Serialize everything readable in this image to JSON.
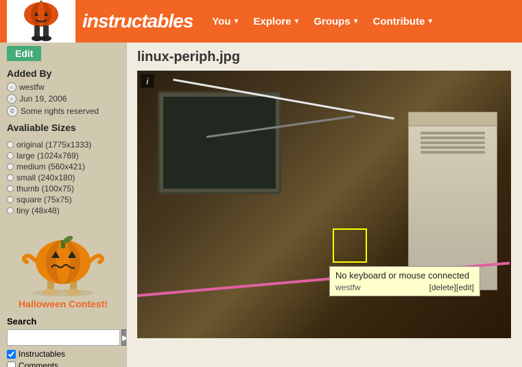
{
  "header": {
    "logo_text": "instructables",
    "nav": [
      {
        "label": "You",
        "arrow": "▼"
      },
      {
        "label": "Explore",
        "arrow": "▼"
      },
      {
        "label": "Groups",
        "arrow": "▼"
      },
      {
        "label": "Contribute",
        "arrow": "▼"
      }
    ]
  },
  "sidebar": {
    "edit_btn": "Edit",
    "added_by_label": "Added By",
    "author": "westfw",
    "date": "Jun 19, 2006",
    "rights": "Some rights reserved",
    "sizes_title": "Avaliable Sizes",
    "sizes": [
      "original (1775x1333)",
      "large (1024x769)",
      "medium (560x421)",
      "small (240x180)",
      "thumb (100x75)",
      "square (75x75)",
      "tiny (48x48)"
    ],
    "halloween_link": "Halloween Contest!",
    "search_label": "Search",
    "search_placeholder": "",
    "search_btn": "▶",
    "checkboxes": [
      {
        "label": "Instructables",
        "checked": true
      },
      {
        "label": "Comments",
        "checked": false
      }
    ]
  },
  "content": {
    "image_title": "linux-periph.jpg",
    "info_i": "i",
    "tooltip": {
      "title": "No keyboard or mouse connected",
      "author": "westfw",
      "delete_link": "[delete]",
      "edit_link": "[edit]"
    }
  }
}
